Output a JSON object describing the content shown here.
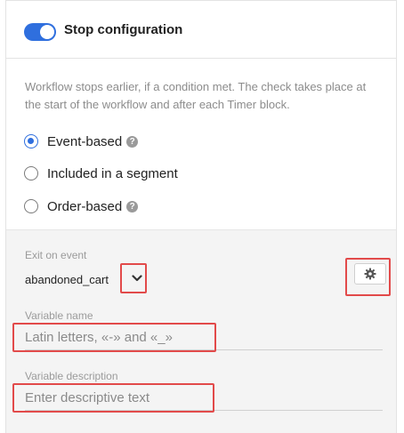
{
  "header": {
    "title": "Stop configuration",
    "toggle_on": true
  },
  "description": "Workflow stops earlier, if a condition met. The check takes place at the start of the workflow and after each Timer block.",
  "options": [
    {
      "label": "Event-based",
      "checked": true,
      "help": "?"
    },
    {
      "label": "Included in a segment",
      "checked": false
    },
    {
      "label": "Order-based",
      "checked": false,
      "help": "?"
    }
  ],
  "exit_event": {
    "label": "Exit on event",
    "value": "abandoned_cart"
  },
  "variable_name": {
    "label": "Variable name",
    "placeholder": "Latin letters, «-» and «_»",
    "value": ""
  },
  "variable_description": {
    "label": "Variable description",
    "placeholder": "Enter descriptive text",
    "value": ""
  },
  "colors": {
    "accent": "#2f6fde",
    "highlight": "#e24a4a",
    "section_bg": "#f4f4f4"
  },
  "icons": {
    "event_dropdown": "chevron-down-icon",
    "settings": "gear-icon",
    "help": "help-icon"
  }
}
